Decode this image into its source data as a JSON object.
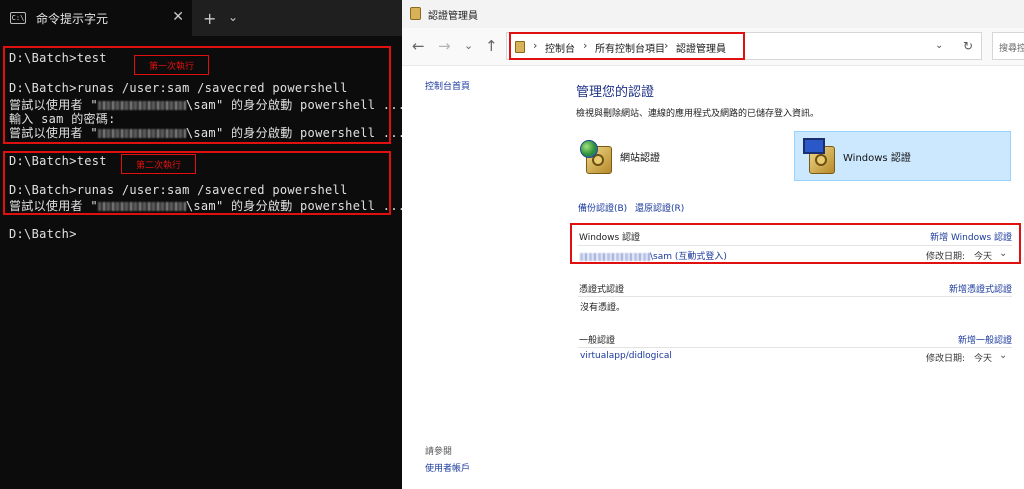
{
  "terminal": {
    "tab_title": "命令提示字元",
    "tab_icon": "C:\\",
    "close_glyph": "✕",
    "new_tab_glyph": "+",
    "dropdown_glyph": "⌄",
    "block1_label": "第一次執行",
    "block2_label": "第二次執行",
    "lines": {
      "l1": "D:\\Batch>test",
      "l2": "D:\\Batch>runas /user:sam /savecred powershell",
      "l3a": "嘗試以使用者 \"",
      "l3b": "\\sam\" 的身分啟動 powershell ...",
      "l4": "輸入 sam 的密碼:",
      "l5a": "嘗試以使用者 \"",
      "l5b": "\\sam\" 的身分啟動 powershell ...",
      "l6": "D:\\Batch>test",
      "l7": "D:\\Batch>runas /user:sam /savecred powershell",
      "l8a": "嘗試以使用者 \"",
      "l8b": "\\sam\" 的身分啟動 powershell ...",
      "l9": "D:\\Batch>"
    }
  },
  "credman": {
    "window_title": "認證管理員",
    "nav": {
      "back": "←",
      "forward": "→",
      "dropdown": "⌄",
      "up": "↑",
      "refresh": "↻",
      "address_dropdown": "⌄"
    },
    "breadcrumb": [
      "控制台",
      "所有控制台項目",
      "認證管理員"
    ],
    "breadcrumb_sep": "›",
    "search_placeholder": "搜尋控",
    "sidebar": {
      "home": "控制台首頁",
      "see_also": "請參閱",
      "user_accounts": "使用者帳戶"
    },
    "heading": "管理您的認證",
    "description": "檢視與刪除網站、連線的應用程式及網路的已儲存登入資訊。",
    "tiles": {
      "web": "網站認證",
      "windows": "Windows 認證"
    },
    "backup": "備份認證(B)",
    "restore": "還原認證(R)",
    "sections": {
      "windows": {
        "title": "Windows 認證",
        "add": "新增 Windows 認證",
        "row_name_suffix": "\\sam (互動式登入)",
        "row_date_label": "修改日期:",
        "row_date": "今天"
      },
      "cert": {
        "title": "憑證式認證",
        "add": "新增憑證式認證",
        "empty": "沒有憑證。"
      },
      "generic": {
        "title": "一般認證",
        "add": "新增一般認證",
        "row_name": "virtualapp/didlogical",
        "row_date_label": "修改日期:",
        "row_date": "今天"
      }
    },
    "chevron": "⌄"
  },
  "colors": {
    "annotation_red": "#e01010",
    "link_blue": "#1b3a9c",
    "selected_tile": "#cce8ff"
  }
}
